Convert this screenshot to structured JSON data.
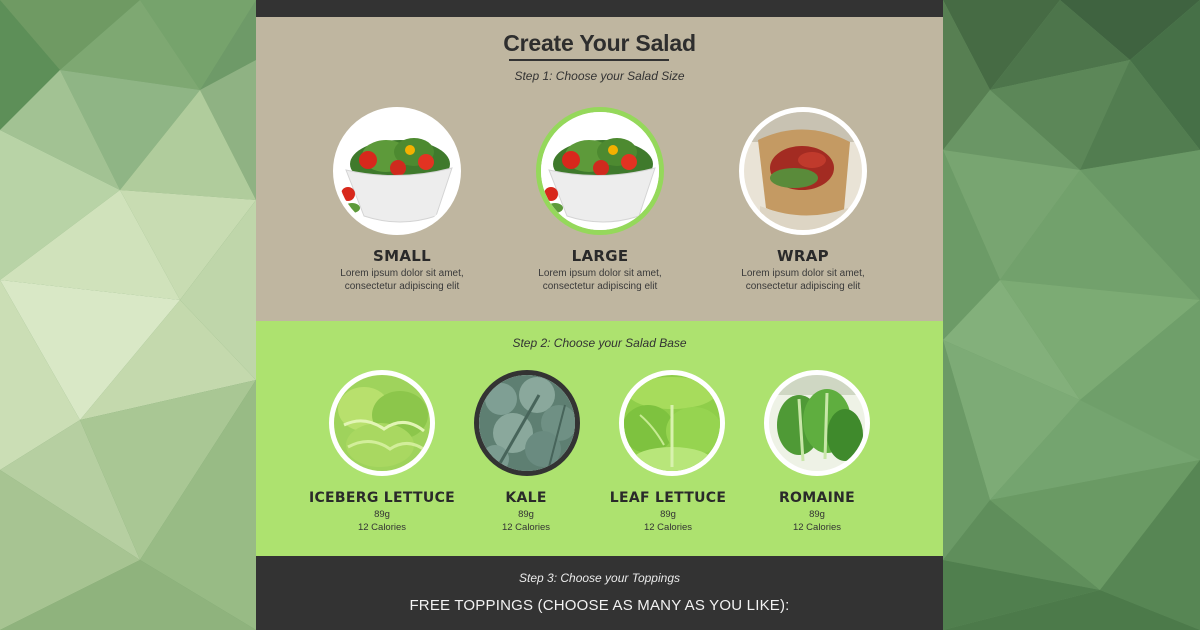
{
  "builder": {
    "title": "Create Your Salad",
    "step1": {
      "label": "Step 1: Choose your Salad Size",
      "options": [
        {
          "name": "SMALL",
          "desc_line1": "Lorem ipsum dolor sit amet,",
          "desc_line2": "consectetur adipiscing elit",
          "image": "salad-bowl-image",
          "selected": false
        },
        {
          "name": "LARGE",
          "desc_line1": "Lorem ipsum dolor sit amet,",
          "desc_line2": "consectetur adipiscing elit",
          "image": "salad-bowl-image",
          "selected": true
        },
        {
          "name": "WRAP",
          "desc_line1": "Lorem ipsum dolor sit amet,",
          "desc_line2": "consectetur adipiscing elit",
          "image": "wrap-image",
          "selected": false
        }
      ]
    },
    "step2": {
      "label": "Step 2: Choose your Salad Base",
      "options": [
        {
          "name": "ICEBERG LETTUCE",
          "weight": "89g",
          "calories": "12 Calories",
          "image": "iceberg-lettuce-image",
          "selected": false
        },
        {
          "name": "KALE",
          "weight": "89g",
          "calories": "12 Calories",
          "image": "kale-image",
          "selected": true
        },
        {
          "name": "LEAF LETTUCE",
          "weight": "89g",
          "calories": "12 Calories",
          "image": "leaf-lettuce-image",
          "selected": false
        },
        {
          "name": "ROMAINE",
          "weight": "89g",
          "calories": "12 Calories",
          "image": "romaine-image",
          "selected": false
        }
      ]
    },
    "step3": {
      "label": "Step 3: Choose your Toppings",
      "free_title": "FREE TOPPINGS (CHOOSE AS MANY AS YOU LIKE):"
    }
  },
  "colors": {
    "step1_bg": "#bfb6a0",
    "step2_bg": "#ade26f",
    "dark_bg": "#333333",
    "selected_accent": "#95d85b"
  }
}
